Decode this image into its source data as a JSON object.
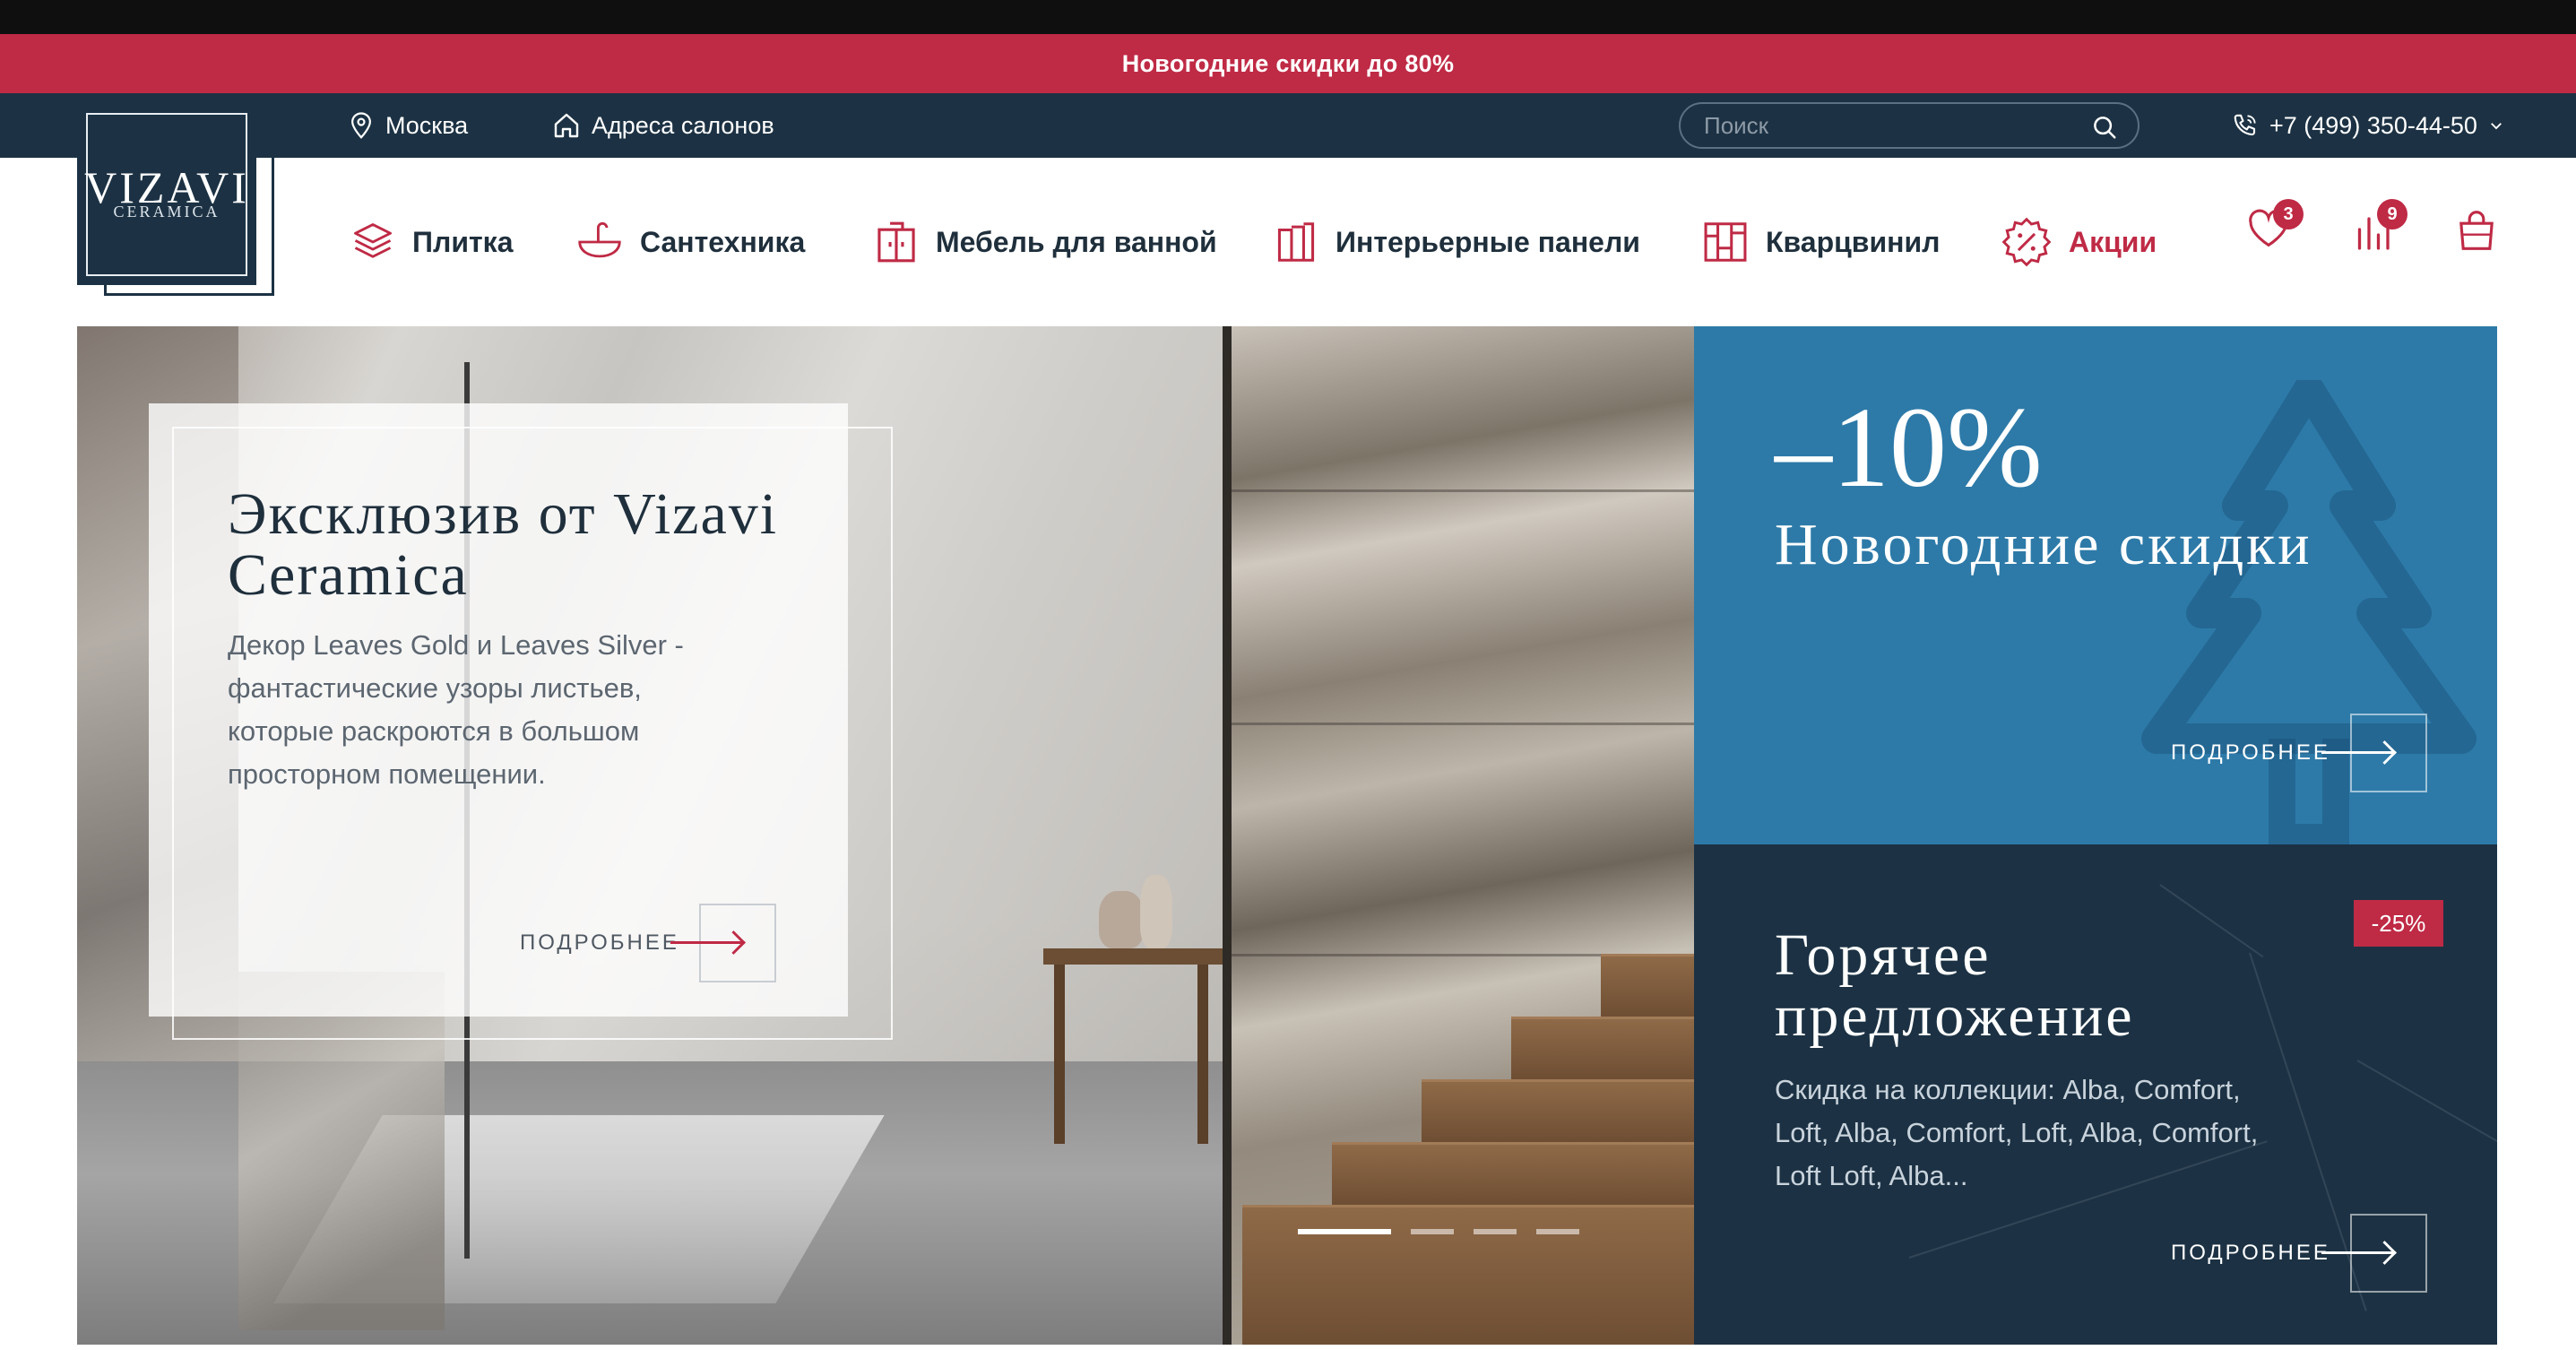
{
  "promo_bar": {
    "text": "Новогодние скидки до 80%"
  },
  "utility_bar": {
    "city": "Москва",
    "salons": "Адреса салонов",
    "search_placeholder": "Поиск",
    "phone": "+7 (499) 350-44-50"
  },
  "logo": {
    "brand": "VIZAVI",
    "sub": "CERAMICA"
  },
  "nav": {
    "items": [
      {
        "label": "Плитка",
        "icon": "tiles-icon"
      },
      {
        "label": "Сантехника",
        "icon": "sink-icon"
      },
      {
        "label": "Мебель для ванной",
        "icon": "cabinet-icon"
      },
      {
        "label": "Интерьерные панели",
        "icon": "panels-icon"
      },
      {
        "label": "Кварцвинил",
        "icon": "vinyl-icon"
      },
      {
        "label": "Акции",
        "icon": "discount-icon"
      }
    ],
    "favorites_count": "3",
    "compare_count": "9"
  },
  "hero": {
    "title": "Эксклюзив от Vizavi Ceramica",
    "text": "Декор Leaves Gold и Leaves Silver - фантастические узоры листьев, которые раскроются в большом просторном помещении.",
    "more": "ПОДРОБНЕЕ",
    "slides_total": 4,
    "active_slide": 1
  },
  "sale_panel": {
    "percent": "–10%",
    "title": "Новогодние скидки",
    "more": "ПОДРОБНЕЕ"
  },
  "hot_panel": {
    "badge": "-25%",
    "title": "Горячее предложение",
    "text": "Скидка на коллекции: Alba, Comfort, Loft, Alba, Comfort, Loft, Alba, Comfort, Loft Loft, Alba...",
    "more": "ПОДРОБНЕЕ"
  },
  "colors": {
    "accent_red": "#bf2a45",
    "navy": "#1c3244",
    "sale_blue": "#2d7aa8"
  }
}
